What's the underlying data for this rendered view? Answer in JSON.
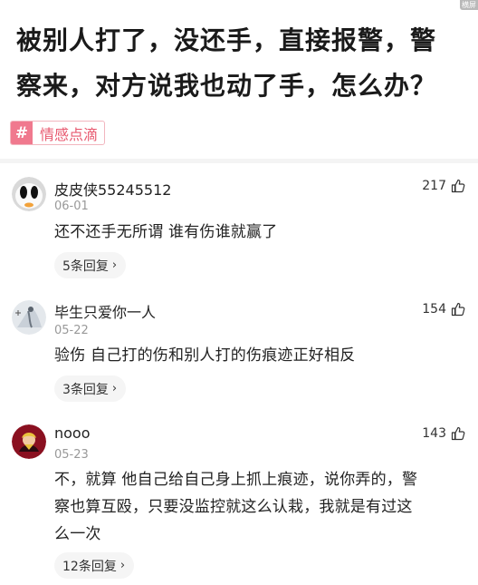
{
  "corner_badge": "横屏",
  "question": {
    "line1": "被别人打了，没还手，直接报警，警",
    "line2": "察来，对方说我也动了手，怎么办？"
  },
  "topic": {
    "icon": "#",
    "label": "情感点滴"
  },
  "comments": [
    {
      "username": "皮皮侠55245512",
      "date": "06-01",
      "likes": "217",
      "text": [
        "还不还手无所谓 谁有伤谁就赢了"
      ],
      "replies": "5条回复"
    },
    {
      "username": "毕生只爱你一人",
      "date": "05-22",
      "likes": "154",
      "text": [
        "验伤  自己打的伤和别人打的伤痕迹正好相反"
      ],
      "replies": "3条回复"
    },
    {
      "username": "nooo",
      "date": "05-23",
      "likes": "143",
      "text": [
        "不，就算 他自己给自己身上抓上痕迹，说你弄的，警",
        "察也算互殴，只要没监控就这么认栽，我就是有过这",
        "么一次"
      ],
      "replies": "12条回复"
    }
  ],
  "colors": {
    "tag_icon": "#f0798e",
    "tag_text": "#e85a70",
    "date": "#999999"
  }
}
